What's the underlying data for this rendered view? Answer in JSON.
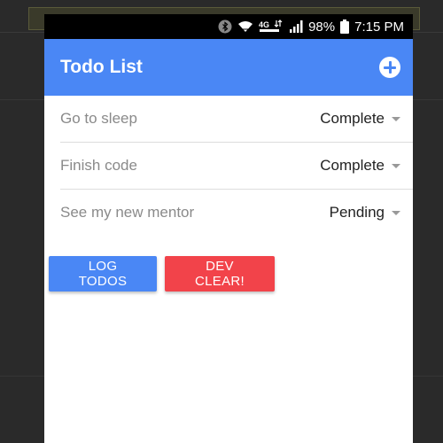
{
  "colors": {
    "appbar": "#4a87f5",
    "log_button": "#4a87f5",
    "clear_button": "#f2434a",
    "statusbar": "#000000"
  },
  "statusbar": {
    "icons": [
      "bluetooth-icon",
      "wifi-icon",
      "4g-icon",
      "signal-icon",
      "battery-icon"
    ],
    "network": "4G",
    "battery": "98%",
    "time": "7:15 PM"
  },
  "appbar": {
    "title": "Todo List",
    "add_icon": "add-circle-icon"
  },
  "todos": [
    {
      "text": "Go to sleep",
      "status": "Complete"
    },
    {
      "text": "Finish code",
      "status": "Complete"
    },
    {
      "text": "See my new mentor",
      "status": "Pending"
    }
  ],
  "actions": {
    "log_label": "LOG TODOS",
    "clear_label": "DEV CLEAR!"
  }
}
